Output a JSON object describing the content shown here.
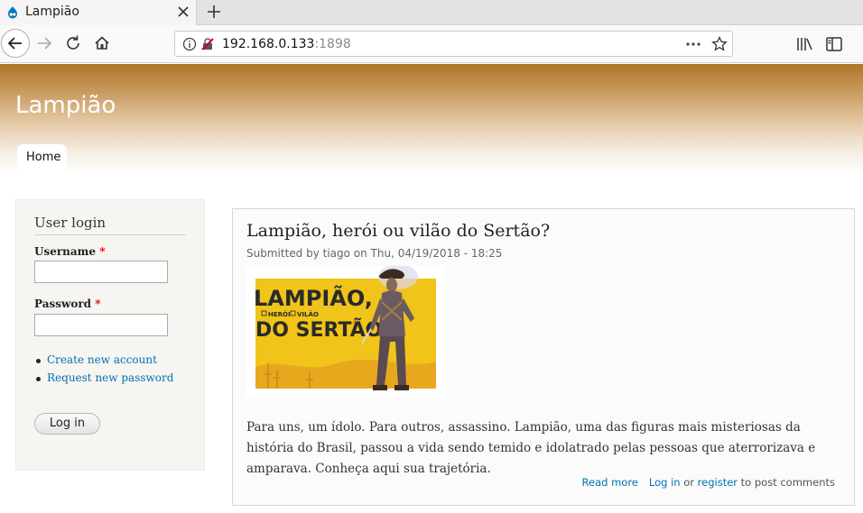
{
  "browser": {
    "tab_title": "Lampião",
    "url_host": "192.168.0.133",
    "url_port": ":1898"
  },
  "site": {
    "name": "Lampião",
    "menu": [
      {
        "label": "Home"
      }
    ]
  },
  "sidebar": {
    "block_title": "User login",
    "username_label": "Username",
    "password_label": "Password",
    "required_mark": "*",
    "links": [
      {
        "label": "Create new account"
      },
      {
        "label": "Request new password"
      }
    ],
    "login_button": "Log in"
  },
  "article": {
    "title": "Lampião, herói ou vilão do Sertão?",
    "meta": "Submitted by tiago on Thu, 04/19/2018 - 18:25",
    "image_text": {
      "line1": "LAMPIÃO,",
      "checkbox1": "HERÓI",
      "checkbox2": "VILÃO",
      "line2": "DO SERTÃO"
    },
    "body": "Para uns, um ídolo. Para outros, assassino. Lampião, uma das figuras mais misteriosas da história do Brasil, passou a vida sendo temido e idolatrado pelas pessoas que aterrorizava e amparava. Conheça aqui sua trajetória.",
    "read_more": "Read more",
    "login_link": "Log in",
    "or_text": "or",
    "register_link": "register",
    "post_comments_text": "to post comments"
  },
  "colors": {
    "link": "#0071b3",
    "header_top": "#b07425",
    "poster_yellow": "#f0c419"
  }
}
